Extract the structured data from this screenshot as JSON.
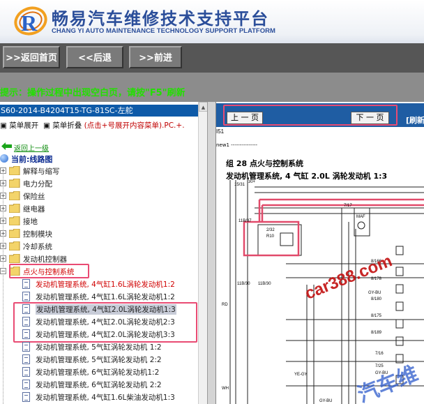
{
  "header": {
    "title": "畅易汽车维修技术支持平台",
    "subtitle": "CHANG YI AUTO MAINTENANCE TECHNOLOGY SUPPORT PLATFORM"
  },
  "nav": {
    "home": ">>返回首页",
    "back": "<<后退",
    "forward": ">>前进"
  },
  "tip": "提示：操作过程中出现空白页，请按\"F5\"刷新",
  "left": {
    "title": "S60-2014-B4204T15-TG-81SC-左舵",
    "tools": {
      "expand": "菜单展开",
      "collapse": "菜单折叠",
      "hint": "(点击+号展开内容菜单).PC.+."
    },
    "back_link": "返回上一级",
    "current": "当前:线路图",
    "folders": [
      "解释与缩写",
      "电力分配",
      "保险丝",
      "继电器",
      "接地",
      "控制模块",
      "冷却系统",
      "发动机控制器",
      "点火与控制系统"
    ],
    "docs": [
      "发动机管理系统, 4气缸1.6L涡轮发动机1:2",
      "发动机管理系统, 4气缸1.6L涡轮发动机1:2",
      "发动机管理系统, 4气缸2.0L涡轮发动机1:3",
      "发动机管理系统, 4气缸2.0L涡轮发动机2:3",
      "发动机管理系统, 4气缸2.0L涡轮发动机3:3",
      "发动机管理系统, 5气缸涡轮发动机 1:2",
      "发动机管理系统, 5气缸涡轮发动机 2:2",
      "发动机管理系统, 6气缸涡轮发动机1:2",
      "发动机管理系统, 6气缸涡轮发动机 2:2",
      "发动机管理系统, 4气缸1.6L柴油发动机1:3"
    ]
  },
  "right": {
    "prev": "上 一 页",
    "next": "下 一 页",
    "refresh": "[刷新",
    "page_code": "I51",
    "note": "new1 ---------------",
    "doc_title1": "组 28 点火与控制系统",
    "doc_title2": "发动机管理系统, 4 气缸 2.0L 涡轮发动机 1:3",
    "labels": [
      "15/31",
      "30+",
      "7/17",
      "MAF",
      "2/32",
      "R10",
      "8/166",
      "8/178",
      "GY-BU",
      "8/180",
      "8/175",
      "8/189",
      "7/16",
      "7/25",
      "GY-BU",
      "RD",
      "WH",
      "YE-GY",
      "GY-BU",
      "11B/37",
      "11B/30",
      "11B/30"
    ],
    "watermark": "car388.com",
    "watermark2": "汽车维"
  },
  "colors": {
    "brand": "#2b4e9a",
    "tip": "#22e000",
    "title_bar": "#0e5aa8",
    "highlight": "#e94b73",
    "watermark": "#c21010"
  }
}
